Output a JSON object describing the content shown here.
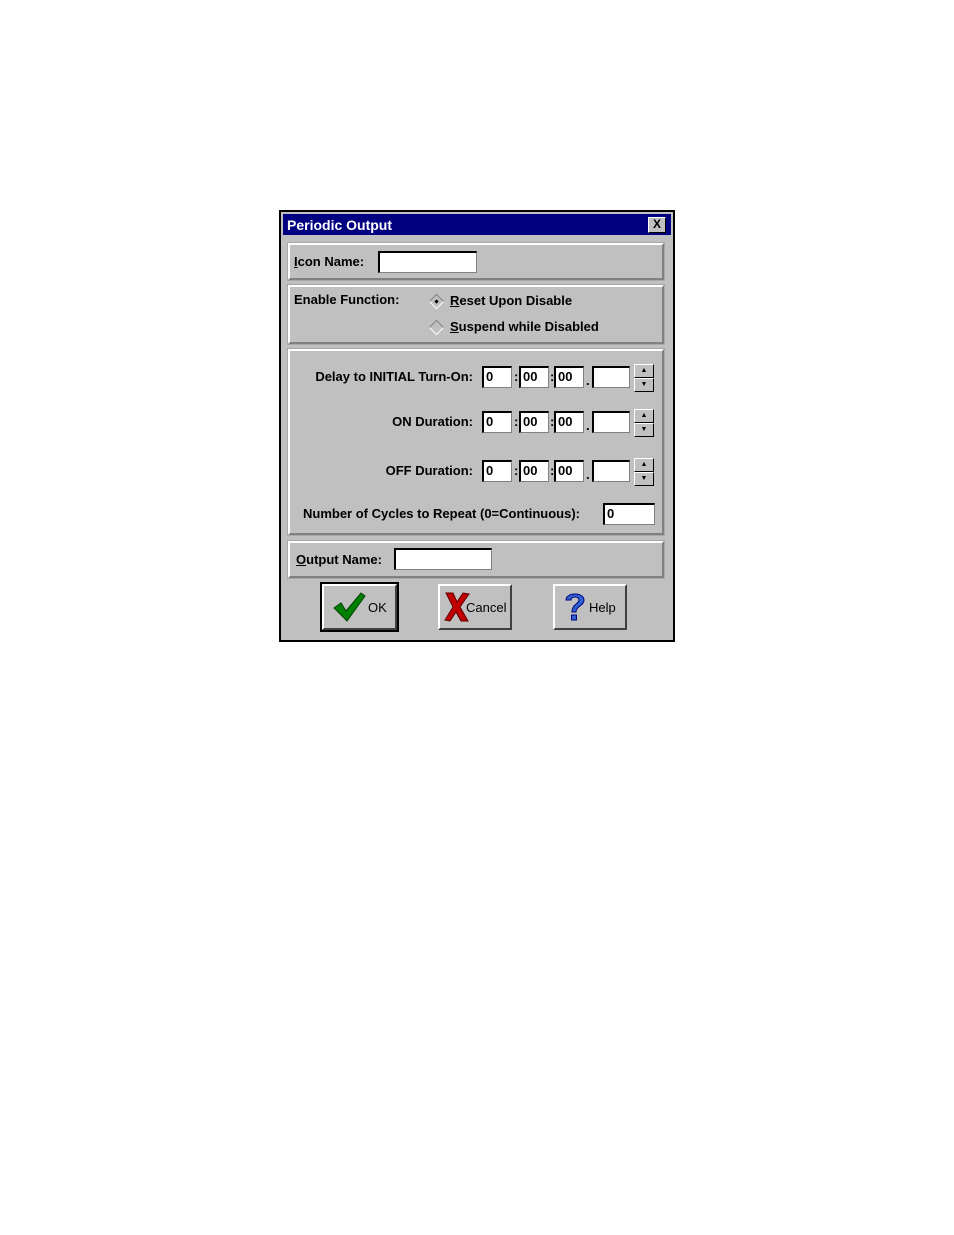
{
  "window": {
    "title": "Periodic Output",
    "close_glyph": "X"
  },
  "icon_name": {
    "label": "Icon Name:",
    "value": ""
  },
  "enable_function": {
    "label": "Enable Function:",
    "options": [
      {
        "label": "Reset Upon Disable",
        "selected": true
      },
      {
        "label": "Suspend while Disabled",
        "selected": false
      }
    ]
  },
  "timers": [
    {
      "label": "Delay to INITIAL Turn-On:",
      "h": "0",
      "m": "00",
      "s": "00",
      "frac": ""
    },
    {
      "label": "ON Duration:",
      "h": "0",
      "m": "00",
      "s": "00",
      "frac": ""
    },
    {
      "label": "OFF Duration:",
      "h": "0",
      "m": "00",
      "s": "00",
      "frac": ""
    }
  ],
  "separators": {
    "colon": ":",
    "dot": "."
  },
  "cycles": {
    "label": "Number of Cycles to Repeat (0=Continuous):",
    "value": "0"
  },
  "output_name": {
    "label": "Output Name:",
    "value": ""
  },
  "buttons": {
    "ok": {
      "label": "OK",
      "icon": "checkmark-icon",
      "icon_color": "#008000"
    },
    "cancel": {
      "label": "Cancel",
      "icon": "x-mark-icon",
      "icon_color": "#c00000"
    },
    "help": {
      "label": "Help",
      "icon": "question-mark-icon",
      "icon_color": "#0000c0"
    }
  }
}
